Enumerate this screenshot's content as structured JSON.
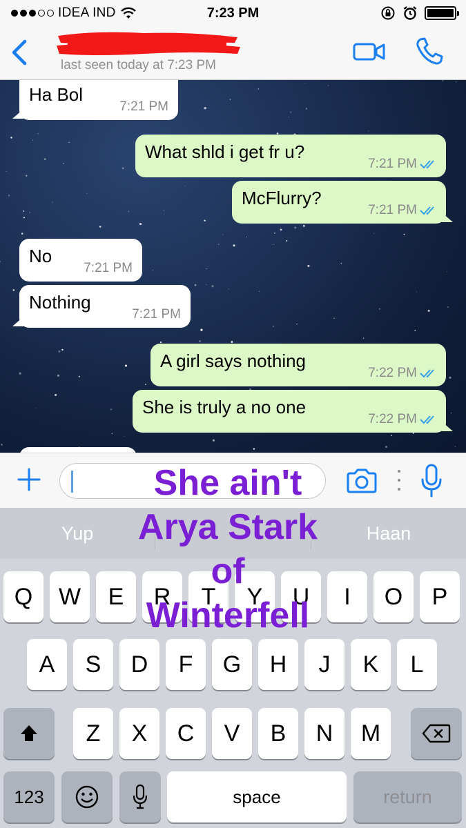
{
  "status_bar": {
    "carrier": "IDEA IND",
    "time": "7:23 PM",
    "signal_icon": "signal-dots-icon",
    "wifi_icon": "wifi-icon",
    "lock_icon": "rotation-lock-icon",
    "alarm_icon": "alarm-icon",
    "battery_icon": "battery-icon"
  },
  "header": {
    "contact_name": "",
    "last_seen": "last seen today at 7:23 PM",
    "accent": "#1a7ff0"
  },
  "messages": [
    {
      "dir": "in",
      "text": "Ha Bol",
      "time": "7:21 PM"
    },
    {
      "dir": "out",
      "text": "What shld i get fr u?",
      "time": "7:21 PM"
    },
    {
      "dir": "out",
      "text": "McFlurry?",
      "time": "7:21 PM"
    },
    {
      "dir": "in",
      "text": "No",
      "time": "7:21 PM"
    },
    {
      "dir": "in",
      "text": "Nothing",
      "time": "7:21 PM"
    },
    {
      "dir": "out",
      "text": "A girl says nothing",
      "time": "7:22 PM"
    },
    {
      "dir": "out",
      "text": "She is truly a no one",
      "time": "7:22 PM"
    }
  ],
  "composer": {
    "text_value": ""
  },
  "keyboard": {
    "suggestions": [
      "Yup",
      "",
      "Haan"
    ],
    "row1": [
      "Q",
      "W",
      "E",
      "R",
      "T",
      "Y",
      "U",
      "I",
      "O",
      "P"
    ],
    "row2": [
      "A",
      "S",
      "D",
      "F",
      "G",
      "H",
      "J",
      "K",
      "L"
    ],
    "row3": [
      "Z",
      "X",
      "C",
      "V",
      "B",
      "N",
      "M"
    ],
    "numbers_label": "123",
    "space_label": "space",
    "return_label": "return"
  },
  "overlay_caption": {
    "lines": [
      "She ain't",
      "Arya Stark",
      "of",
      "Winterfell"
    ],
    "color": "#7a1fd4"
  }
}
